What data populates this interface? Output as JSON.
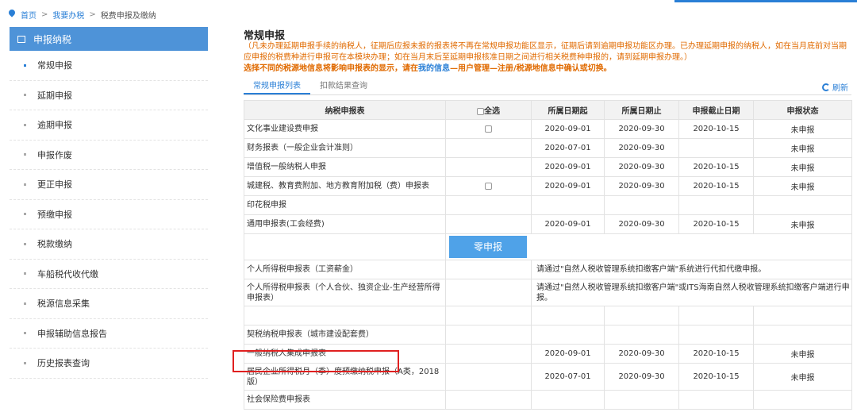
{
  "breadcrumb": {
    "home": "首页",
    "sep1": ">",
    "level2": "我要办税",
    "sep2": ">",
    "level3": "税费申报及缴纳"
  },
  "sidebar": {
    "header": "申报纳税",
    "items": [
      {
        "label": "常规申报"
      },
      {
        "label": "延期申报"
      },
      {
        "label": "逾期申报"
      },
      {
        "label": "申报作废"
      },
      {
        "label": "更正申报"
      },
      {
        "label": "预缴申报"
      },
      {
        "label": "税款缴纳"
      },
      {
        "label": "车船税代收代缴"
      },
      {
        "label": "税源信息采集"
      },
      {
        "label": "申报辅助信息报告"
      },
      {
        "label": "历史报表查询"
      }
    ]
  },
  "main": {
    "title": "常规申报",
    "notice": "（凡未办理延期申报手续的纳税人，征期后应报未报的报表将不再在常规申报功能区显示，征期后请到逾期申报功能区办理。已办理延期申报的纳税人，如在当月底前对当期应申报的税费种进行申报可在本模块办理；如在当月末后至延期申报核准日期之间进行相关税费种申报的，请到延期申报办理。）",
    "notice_bold_a": "选择不同的税源地信息将影响申报表的显示，请在",
    "notice_bold_link": "我的信息",
    "notice_bold_b": "—用户管理—注册/税源地信息中确认或切换。",
    "tabs": [
      "常规申报列表",
      "扣款结果查询"
    ],
    "refresh": "刷新",
    "zero_button": "零申报"
  },
  "table": {
    "headers": [
      "纳税申报表",
      "全选",
      "所属日期起",
      "所属日期止",
      "申报截止日期",
      "申报状态"
    ],
    "rows_top": [
      {
        "name": "文化事业建设费申报",
        "check": true,
        "start": "2020-09-01",
        "end": "2020-09-30",
        "deadline": "2020-10-15",
        "status": "未申报"
      },
      {
        "name": "财务报表（一般企业会计准则）",
        "check": false,
        "start": "2020-07-01",
        "end": "2020-09-30",
        "deadline": "",
        "status": "未申报"
      },
      {
        "name": "增值税一般纳税人申报",
        "check": false,
        "start": "2020-09-01",
        "end": "2020-09-30",
        "deadline": "2020-10-15",
        "status": "未申报"
      },
      {
        "name": "城建税、教育费附加、地方教育附加税（费）申报表",
        "check": true,
        "start": "2020-09-01",
        "end": "2020-09-30",
        "deadline": "2020-10-15",
        "status": "未申报"
      },
      {
        "name": "印花税申报",
        "check": false,
        "start": "",
        "end": "",
        "deadline": "",
        "status": ""
      },
      {
        "name": "通用申报表(工会经费)",
        "check": false,
        "start": "2020-09-01",
        "end": "2020-09-30",
        "deadline": "2020-10-15",
        "status": "未申报"
      }
    ],
    "row_personal1": {
      "name": "个人所得税申报表（工资薪金）",
      "note": "请通过\"自然人税收管理系统扣缴客户端\"系统进行代扣代缴申报。"
    },
    "row_personal2": {
      "name": "个人所得税申报表（个人合伙、独资企业-生产经营所得申报表）",
      "note": "请通过\"自然人税收管理系统扣缴客户端\"或ITS海南自然人税收管理系统扣缴客户端进行申报。"
    },
    "row_deed": {
      "name": "契税纳税申报表（城市建设配套费）"
    },
    "row_general": {
      "name": "一般纳税人集成申报表",
      "start": "2020-09-01",
      "end": "2020-09-30",
      "deadline": "2020-10-15",
      "status": "未申报"
    },
    "row_cit": {
      "name": "居民企业所得税月（季）度预缴纳税申报（A类，2018版）",
      "start": "2020-07-01",
      "end": "2020-09-30",
      "deadline": "2020-10-15",
      "status": "未申报"
    },
    "row_social": {
      "name": "社会保险费申报表"
    }
  }
}
